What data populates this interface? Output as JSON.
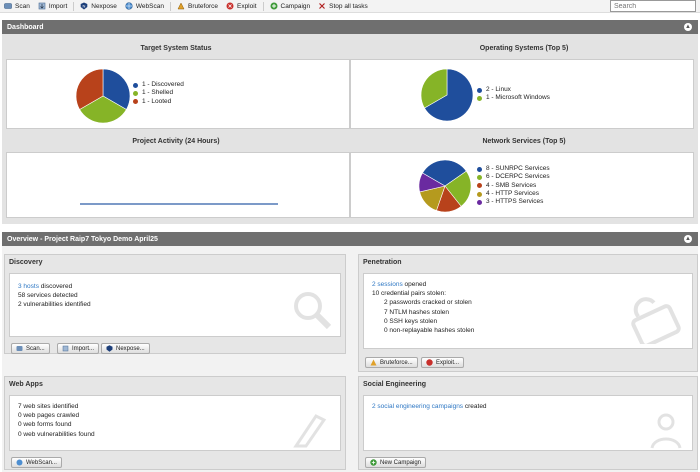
{
  "toolbar": {
    "items": [
      {
        "label": "Scan",
        "icon": "scan-icon"
      },
      {
        "label": "Import",
        "icon": "import-icon"
      },
      {
        "label": "Nexpose",
        "icon": "nexpose-icon"
      },
      {
        "label": "WebScan",
        "icon": "webscan-icon"
      },
      {
        "label": "Bruteforce",
        "icon": "bruteforce-icon"
      },
      {
        "label": "Exploit",
        "icon": "exploit-icon"
      },
      {
        "label": "Campaign",
        "icon": "campaign-icon"
      },
      {
        "label": "Stop all tasks",
        "icon": "stop-icon"
      }
    ],
    "search_placeholder": "Search"
  },
  "dashboard": {
    "title": "Dashboard",
    "panels": {
      "target_status": {
        "title": "Target System Status",
        "legend": [
          "1 - Discovered",
          "1 - Shelled",
          "1 - Looted"
        ],
        "colors": [
          "#1f4e9c",
          "#86b427",
          "#b8421b"
        ],
        "values": [
          1,
          1,
          1
        ]
      },
      "os": {
        "title": "Operating Systems (Top 5)",
        "legend": [
          "2 - Linux",
          "1 - Microsoft Windows"
        ],
        "colors": [
          "#1f4e9c",
          "#86b427"
        ],
        "values": [
          2,
          1
        ]
      },
      "activity": {
        "title": "Project Activity (24 Hours)"
      },
      "services": {
        "title": "Network Services (Top 5)",
        "legend": [
          "8 - SUNRPC Services",
          "6 - DCERPC Services",
          "4 - SMB Services",
          "4 - HTTP Services",
          "3 - HTTPS Services"
        ],
        "colors": [
          "#1f4e9c",
          "#86b427",
          "#b8421b",
          "#b59a1e",
          "#6a2aa0"
        ],
        "values": [
          8,
          6,
          4,
          4,
          3
        ]
      }
    }
  },
  "overview": {
    "title": "Overview - Project Raip7 Tokyo Demo April25",
    "discovery": {
      "title": "Discovery",
      "hosts_link": "3 hosts",
      "hosts_rest": " discovered",
      "line2": "58 services detected",
      "line3": "2 vulnerabilities identified",
      "buttons": [
        "Scan...",
        "Import...",
        "Nexpose..."
      ]
    },
    "penetration": {
      "title": "Penetration",
      "sessions_link": "2 sessions",
      "sessions_rest": " opened",
      "line2": "10 credential pairs stolen:",
      "sub": [
        "2 passwords cracked or stolen",
        "7 NTLM hashes stolen",
        "0 SSH keys stolen",
        "0 non-replayable hashes stolen"
      ],
      "buttons": [
        "Bruteforce...",
        "Exploit..."
      ]
    },
    "webapps": {
      "title": "Web Apps",
      "lines": [
        "7 web sites identified",
        "0 web pages crawled",
        "0 web forms found",
        "0 web vulnerabilities found"
      ],
      "buttons": [
        "WebScan..."
      ]
    },
    "social": {
      "title": "Social Engineering",
      "campaigns_link": "2 social engineering campaigns",
      "campaigns_rest": " created",
      "buttons": [
        "New Campaign"
      ]
    }
  }
}
